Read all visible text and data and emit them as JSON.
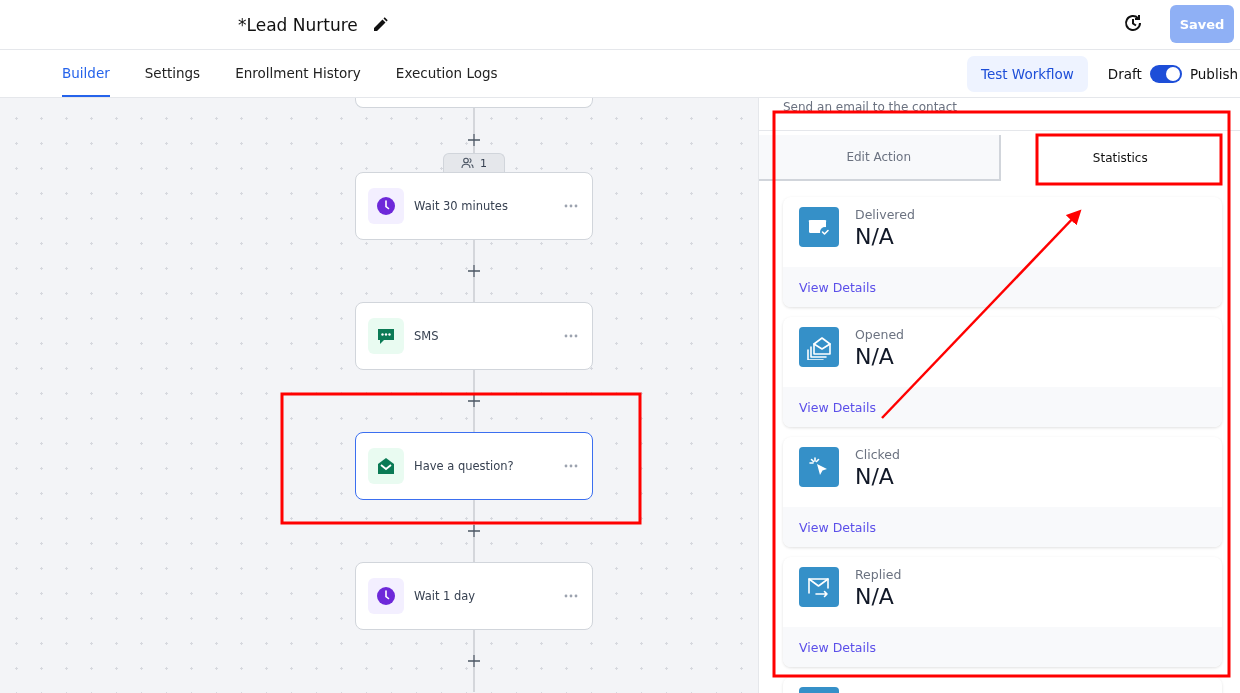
{
  "header": {
    "title": "*Lead Nurture",
    "save_button": "Saved"
  },
  "tabs": [
    {
      "label": "Builder",
      "selected": true
    },
    {
      "label": "Settings",
      "selected": false
    },
    {
      "label": "Enrollment History",
      "selected": false
    },
    {
      "label": "Execution Logs",
      "selected": false
    }
  ],
  "test_button": "Test Workflow",
  "status_toggle": {
    "off_label": "Draft",
    "on_label": "Publish",
    "on": true
  },
  "canvas": {
    "nodes": [
      {
        "kind": "wait",
        "label": "Wait 30 minutes",
        "selected": false,
        "count": "1"
      },
      {
        "kind": "sms",
        "label": "SMS",
        "selected": false
      },
      {
        "kind": "email",
        "label": "Have a question?",
        "selected": true
      },
      {
        "kind": "wait",
        "label": "Wait 1 day",
        "selected": false
      }
    ]
  },
  "panel": {
    "description": "Send an email to the contact",
    "tabs": [
      {
        "label": "Edit Action",
        "selected": false
      },
      {
        "label": "Statistics",
        "selected": true
      }
    ],
    "stats": [
      {
        "kind": "delivered",
        "label": "Delivered",
        "value": "N/A",
        "link": "View Details"
      },
      {
        "kind": "opened",
        "label": "Opened",
        "value": "N/A",
        "link": "View Details"
      },
      {
        "kind": "clicked",
        "label": "Clicked",
        "value": "N/A",
        "link": "View Details"
      },
      {
        "kind": "replied",
        "label": "Replied",
        "value": "N/A",
        "link": "View Details"
      }
    ]
  }
}
